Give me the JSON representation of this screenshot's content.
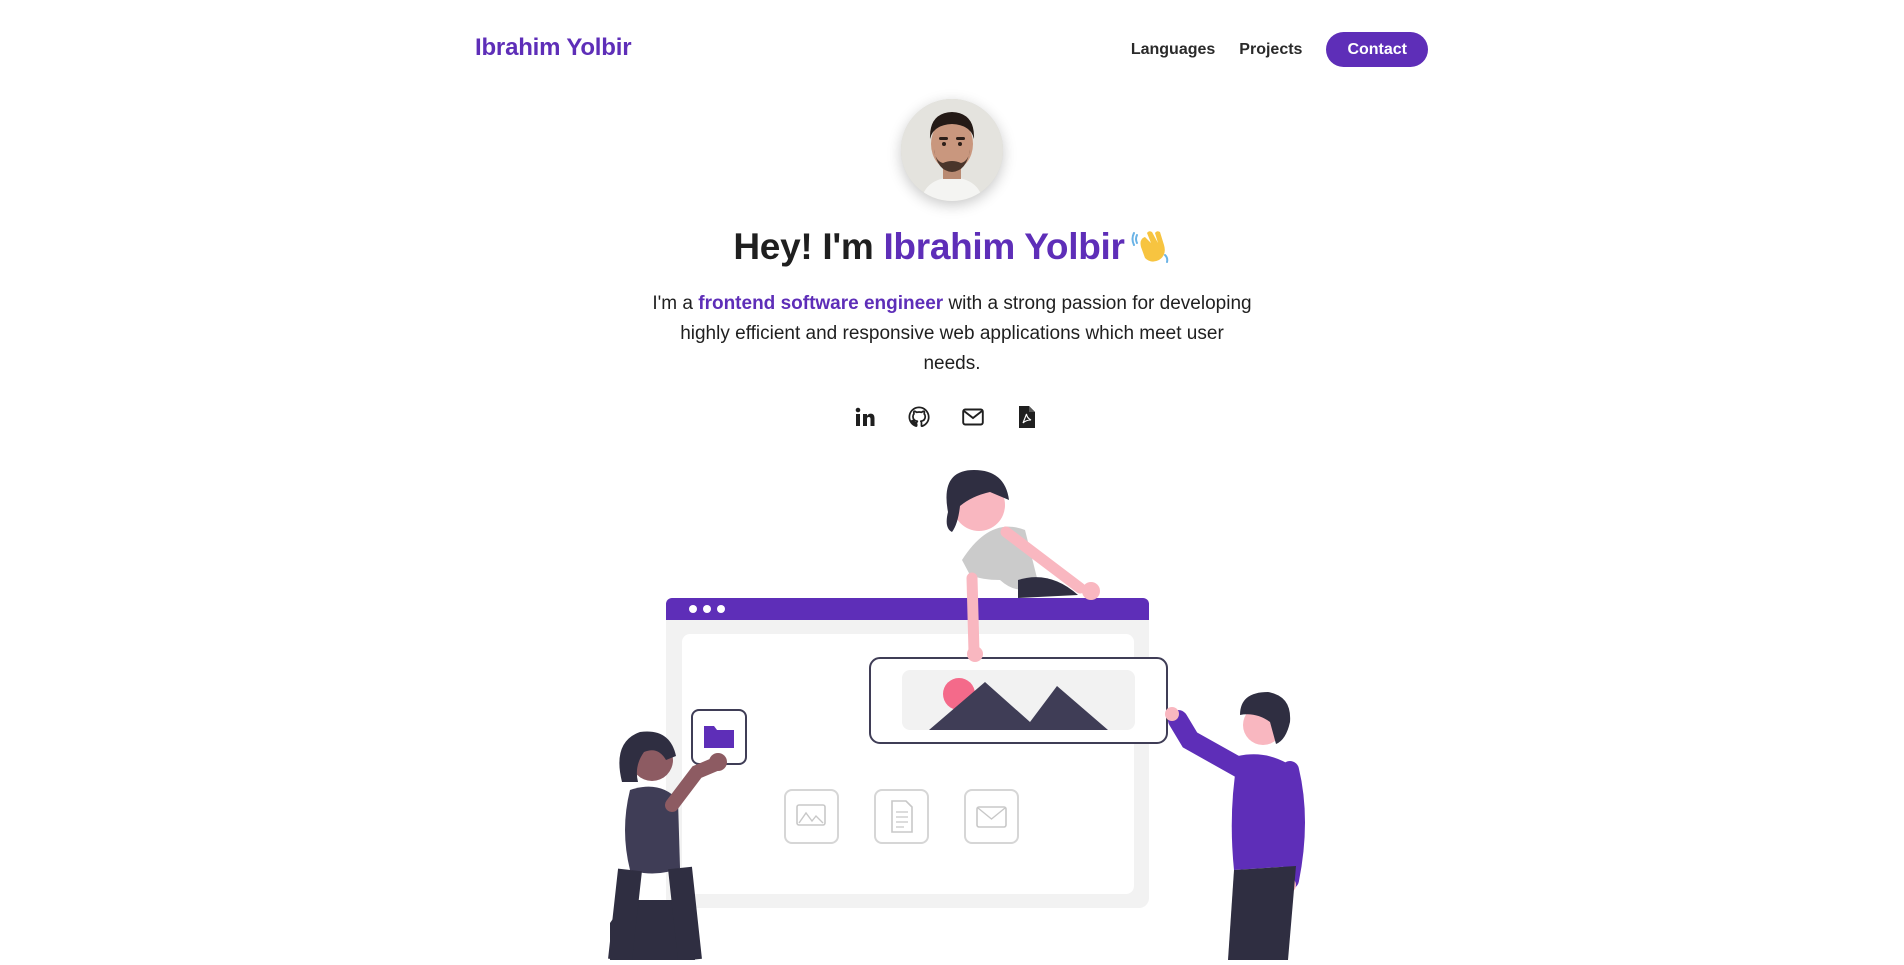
{
  "header": {
    "brand": "Ibrahim Yolbir",
    "nav": [
      {
        "label": "Languages"
      },
      {
        "label": "Projects"
      }
    ],
    "contact_label": "Contact"
  },
  "hero": {
    "title_prefix": "Hey! I'm ",
    "title_name": "Ibrahim Yolbir",
    "title_emoji_icon": "waving-hand-icon",
    "intro_prefix": "I'm a ",
    "intro_role": "frontend software engineer",
    "intro_suffix": " with a strong passion for developing highly efficient and responsive web applications which meet user needs."
  },
  "socials": [
    {
      "icon": "linkedin-icon"
    },
    {
      "icon": "github-icon"
    },
    {
      "icon": "mail-icon"
    },
    {
      "icon": "pdf-resume-icon"
    }
  ],
  "colors": {
    "accent": "#5e2eb8",
    "text": "#1f1f1f",
    "illustration_dark": "#3f3d56",
    "illustration_pink": "#f46a8a",
    "illustration_grey": "#f2f2f2"
  }
}
